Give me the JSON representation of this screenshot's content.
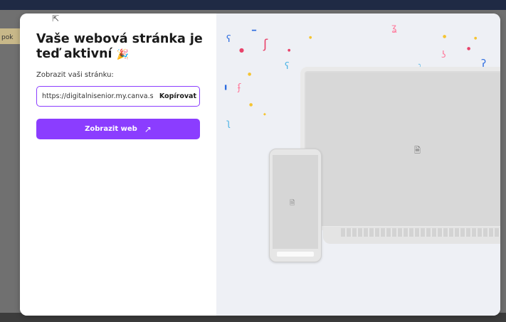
{
  "backdrop": {
    "side_text": "pok"
  },
  "modal": {
    "title_line1": "Vaše webová stránka je",
    "title_line2": "teď aktivní",
    "party_emoji": "🎉",
    "url_label": "Zobrazit vaši stránku:",
    "url_value": "https://digitalnisenior.my.canva.site",
    "copy_label": "Kopírovat",
    "view_label": "Zobrazit web",
    "view_arrow": "↗"
  },
  "icons": {
    "cursor": "mouse-pointer-icon",
    "laptop_file": "file-icon",
    "phone_file": "file-icon"
  },
  "colors": {
    "accent": "#8b3dff",
    "illustration_bg": "#eef0f5",
    "confetti": [
      "#2d6cdf",
      "#e8436a",
      "#f5c431",
      "#ff7a9c",
      "#4bb3e5"
    ]
  }
}
